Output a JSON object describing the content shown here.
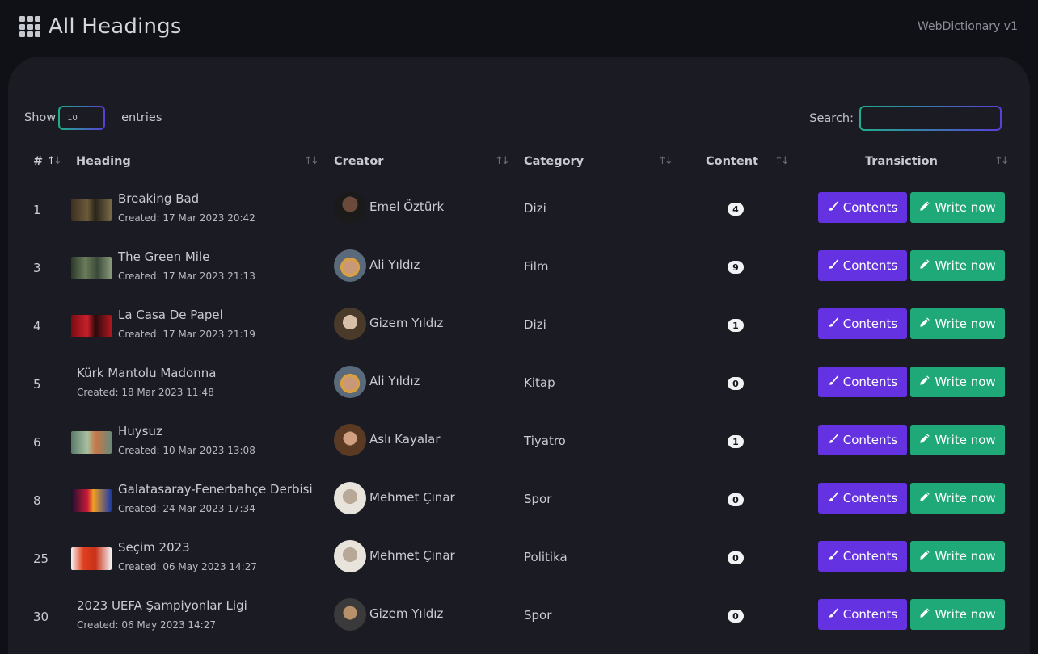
{
  "header": {
    "title": "All Headings",
    "version": "WebDictionary v1"
  },
  "controls": {
    "show_label": "Show",
    "entries_value": "10",
    "entries_label": "entries",
    "search_label": "Search:",
    "search_value": ""
  },
  "table": {
    "columns": {
      "id": "#",
      "heading": "Heading",
      "creator": "Creator",
      "category": "Category",
      "content": "Content",
      "transaction": "Transiction"
    },
    "contents_label": "Contents",
    "write_label": "Write now",
    "rows": [
      {
        "id": "1",
        "heading": "Breaking Bad",
        "created": "Created: 17 Mar 2023 20:42",
        "creator": "Emel Öztürk",
        "category": "Dizi",
        "content": "4",
        "has_thumb": true
      },
      {
        "id": "3",
        "heading": "The Green Mile",
        "created": "Created: 17 Mar 2023 21:13",
        "creator": "Ali Yıldız",
        "category": "Film",
        "content": "9",
        "has_thumb": true
      },
      {
        "id": "4",
        "heading": "La Casa De Papel",
        "created": "Created: 17 Mar 2023 21:19",
        "creator": "Gizem Yıldız",
        "category": "Dizi",
        "content": "1",
        "has_thumb": true
      },
      {
        "id": "5",
        "heading": "Kürk Mantolu Madonna",
        "created": "Created: 18 Mar 2023 11:48",
        "creator": "Ali Yıldız",
        "category": "Kitap",
        "content": "0",
        "has_thumb": false
      },
      {
        "id": "6",
        "heading": "Huysuz",
        "created": "Created: 10 Mar 2023 13:08",
        "creator": "Aslı Kayalar",
        "category": "Tiyatro",
        "content": "1",
        "has_thumb": true
      },
      {
        "id": "8",
        "heading": "Galatasaray-Fenerbahçe Derbisi",
        "created": "Created: 24 Mar 2023 17:34",
        "creator": "Mehmet Çınar",
        "category": "Spor",
        "content": "0",
        "has_thumb": true
      },
      {
        "id": "25",
        "heading": "Seçim 2023",
        "created": "Created: 06 May 2023 14:27",
        "creator": "Mehmet Çınar",
        "category": "Politika",
        "content": "0",
        "has_thumb": true
      },
      {
        "id": "30",
        "heading": "2023 UEFA Şampiyonlar Ligi",
        "created": "Created: 06 May 2023 14:27",
        "creator": "Gizem Yıldız",
        "category": "Spor",
        "content": "0",
        "has_thumb": false
      }
    ]
  },
  "colors": {
    "background": "#101117",
    "panel": "#1b1c23",
    "contents_button": "#6432e0",
    "write_button": "#1fa878"
  },
  "icons": [
    "grid-icon",
    "sort-icon",
    "brush-icon",
    "pencil-icon"
  ]
}
